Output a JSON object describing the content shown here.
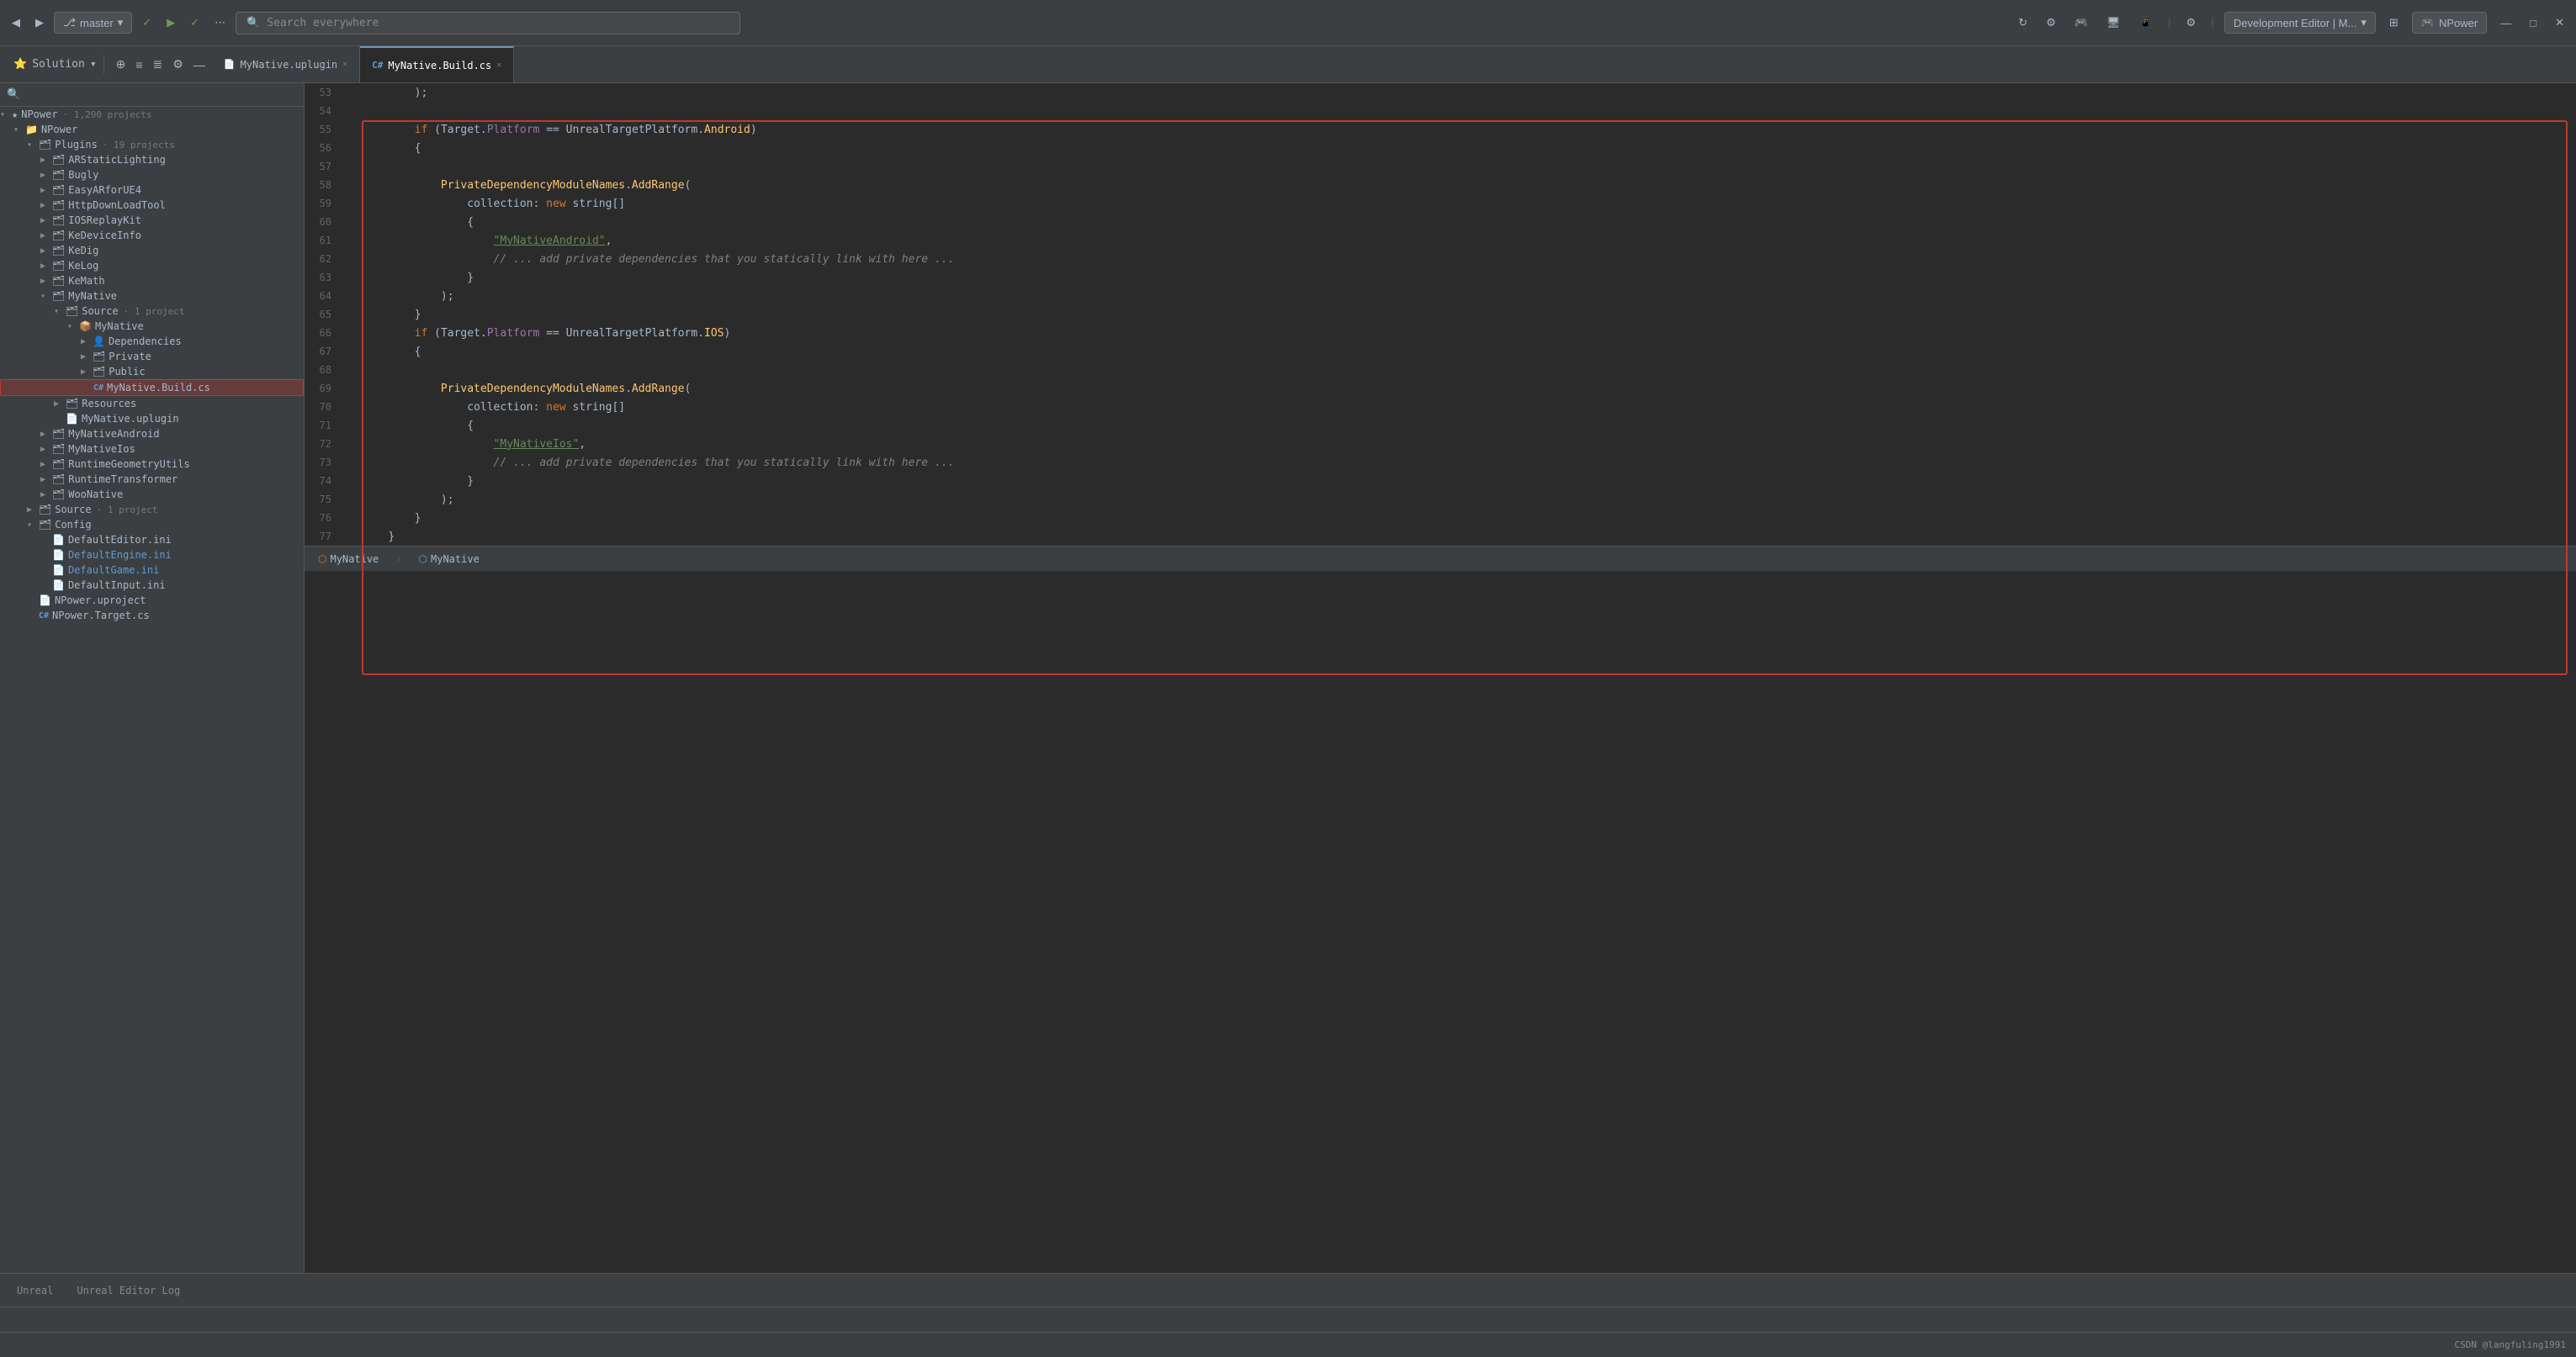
{
  "topbar": {
    "back_icon": "◀",
    "forward_icon": "▶",
    "branch_icon": "⎇",
    "branch_name": "master",
    "check_icon": "✓",
    "run_icon": "▶",
    "build_icon": "🔨",
    "more_icon": "⋯",
    "search_placeholder": "Search everywhere",
    "settings_icon": "⚙",
    "game_icon": "🎮",
    "dev_editor_label": "Development Editor | M...",
    "dropdown_icon": "▾",
    "npower_label": "NPower",
    "window_controls": "— □ ✕"
  },
  "second_toolbar": {
    "solution_label": "Solution",
    "dropdown_icon": "▾",
    "icon1": "⊕",
    "icon2": "≡",
    "icon3": "≣",
    "icon4": "⚙",
    "icon5": "—"
  },
  "file_tabs": [
    {
      "icon": "📄",
      "icon_color": "#cc7832",
      "name": "MyNative.uplugin",
      "active": false,
      "modified": false
    },
    {
      "icon": "C#",
      "icon_color": "#5b9bd5",
      "name": "MyNative.Build.cs",
      "active": true,
      "modified": false
    }
  ],
  "sidebar": {
    "search_placeholder": "",
    "tree": [
      {
        "level": 0,
        "arrow": "▾",
        "icon": "★",
        "label": "NPower",
        "suffix": "· 1,200 projects",
        "color": "normal",
        "indent": 0
      },
      {
        "level": 1,
        "arrow": "▾",
        "icon": "📁",
        "label": "NPower",
        "color": "normal",
        "indent": 1
      },
      {
        "level": 2,
        "arrow": "▾",
        "icon": "🗂",
        "label": "Plugins",
        "suffix": "· 19 projects",
        "color": "normal",
        "indent": 2
      },
      {
        "level": 3,
        "arrow": "▶",
        "icon": "🗂",
        "label": "ARStaticLighting",
        "color": "normal",
        "indent": 3
      },
      {
        "level": 3,
        "arrow": "▶",
        "icon": "🗂",
        "label": "Bugly",
        "color": "normal",
        "indent": 3
      },
      {
        "level": 3,
        "arrow": "▶",
        "icon": "🗂",
        "label": "EasyARforUE4",
        "color": "normal",
        "indent": 3
      },
      {
        "level": 3,
        "arrow": "▶",
        "icon": "🗂",
        "label": "HttpDownLoadTool",
        "color": "normal",
        "indent": 3
      },
      {
        "level": 3,
        "arrow": "▶",
        "icon": "🗂",
        "label": "IOSReplayKit",
        "color": "normal",
        "indent": 3
      },
      {
        "level": 3,
        "arrow": "▶",
        "icon": "🗂",
        "label": "KeDeviceInfo",
        "color": "normal",
        "indent": 3
      },
      {
        "level": 3,
        "arrow": "▶",
        "icon": "🗂",
        "label": "KeDig",
        "color": "normal",
        "indent": 3
      },
      {
        "level": 3,
        "arrow": "▶",
        "icon": "🗂",
        "label": "KeLog",
        "color": "normal",
        "indent": 3
      },
      {
        "level": 3,
        "arrow": "▶",
        "icon": "🗂",
        "label": "KeMath",
        "color": "normal",
        "indent": 3
      },
      {
        "level": 3,
        "arrow": "▾",
        "icon": "🗂",
        "label": "MyNative",
        "color": "normal",
        "indent": 3
      },
      {
        "level": 4,
        "arrow": "▾",
        "icon": "🗂",
        "label": "Source",
        "suffix": "· 1 project",
        "color": "normal",
        "indent": 4
      },
      {
        "level": 5,
        "arrow": "▾",
        "icon": "📦",
        "label": "MyNative",
        "color": "normal",
        "indent": 5
      },
      {
        "level": 6,
        "arrow": "▶",
        "icon": "👤",
        "label": "Dependencies",
        "color": "normal",
        "indent": 6
      },
      {
        "level": 6,
        "arrow": "▶",
        "icon": "🗂",
        "label": "Private",
        "color": "normal",
        "indent": 6
      },
      {
        "level": 6,
        "arrow": "▶",
        "icon": "🗂",
        "label": "Public",
        "color": "normal",
        "indent": 6
      },
      {
        "level": 6,
        "arrow": "",
        "icon": "C#",
        "label": "MyNative.Build.cs",
        "color": "selected",
        "indent": 6
      },
      {
        "level": 4,
        "arrow": "▶",
        "icon": "🗂",
        "label": "Resources",
        "color": "normal",
        "indent": 4
      },
      {
        "level": 4,
        "arrow": "",
        "icon": "📄",
        "label": "MyNative.uplugin",
        "color": "normal",
        "indent": 4
      },
      {
        "level": 3,
        "arrow": "▶",
        "icon": "🗂",
        "label": "MyNativeAndroid",
        "color": "normal",
        "indent": 3
      },
      {
        "level": 3,
        "arrow": "▶",
        "icon": "🗂",
        "label": "MyNativeIos",
        "color": "normal",
        "indent": 3
      },
      {
        "level": 3,
        "arrow": "▶",
        "icon": "🗂",
        "label": "RuntimeGeometryUtils",
        "color": "normal",
        "indent": 3
      },
      {
        "level": 3,
        "arrow": "▶",
        "icon": "🗂",
        "label": "RuntimeTransformer",
        "color": "normal",
        "indent": 3
      },
      {
        "level": 3,
        "arrow": "▶",
        "icon": "🗂",
        "label": "WooNative",
        "color": "normal",
        "indent": 3
      },
      {
        "level": 2,
        "arrow": "▶",
        "icon": "🗂",
        "label": "Source",
        "suffix": "· 1 project",
        "color": "normal",
        "indent": 2
      },
      {
        "level": 2,
        "arrow": "▾",
        "icon": "🗂",
        "label": "Config",
        "color": "normal",
        "indent": 2
      },
      {
        "level": 3,
        "arrow": "",
        "icon": "📄",
        "label": "DefaultEditor.ini",
        "color": "normal",
        "indent": 3
      },
      {
        "level": 3,
        "arrow": "",
        "icon": "📄",
        "label": "DefaultEngine.ini",
        "color": "blue",
        "indent": 3
      },
      {
        "level": 3,
        "arrow": "",
        "icon": "📄",
        "label": "DefaultGame.ini",
        "color": "blue",
        "indent": 3
      },
      {
        "level": 3,
        "arrow": "",
        "icon": "📄",
        "label": "DefaultInput.ini",
        "color": "normal",
        "indent": 3
      },
      {
        "level": 2,
        "arrow": "",
        "icon": "📄",
        "label": "NPower.uproject",
        "color": "normal",
        "indent": 2
      },
      {
        "level": 2,
        "arrow": "",
        "icon": "C#",
        "label": "NPower.Target.cs",
        "color": "normal",
        "indent": 2
      }
    ]
  },
  "code": {
    "lines": [
      {
        "num": 53,
        "content": "        );"
      },
      {
        "num": 54,
        "content": ""
      },
      {
        "num": 55,
        "content": "        if (Target.Platform == UnrealTargetPlatform.Android)",
        "highlight": true
      },
      {
        "num": 56,
        "content": "        {"
      },
      {
        "num": 57,
        "content": ""
      },
      {
        "num": 58,
        "content": "            PrivateDependencyModuleNames.AddRange("
      },
      {
        "num": 59,
        "content": "                collection: new string[]"
      },
      {
        "num": 60,
        "content": "                {"
      },
      {
        "num": 61,
        "content": "                    \"MyNativeAndroid\","
      },
      {
        "num": 62,
        "content": "                    // ... add private dependencies that you statically link with here ..."
      },
      {
        "num": 63,
        "content": "                }"
      },
      {
        "num": 64,
        "content": "            );"
      },
      {
        "num": 65,
        "content": "        }"
      },
      {
        "num": 66,
        "content": "        if (Target.Platform == UnrealTargetPlatform.IOS)"
      },
      {
        "num": 67,
        "content": "        {"
      },
      {
        "num": 68,
        "content": ""
      },
      {
        "num": 69,
        "content": "            PrivateDependencyModuleNames.AddRange("
      },
      {
        "num": 70,
        "content": "                collection: new string[]"
      },
      {
        "num": 71,
        "content": "                {"
      },
      {
        "num": 72,
        "content": "                    \"MyNativeIos\","
      },
      {
        "num": 73,
        "content": "                    // ... add private dependencies that you statically link with here ..."
      },
      {
        "num": 74,
        "content": "                }"
      },
      {
        "num": 75,
        "content": "            );"
      },
      {
        "num": 76,
        "content": "        }"
      },
      {
        "num": 77,
        "content": "    }"
      }
    ]
  },
  "editor_footer": {
    "breadcrumb1_icon": "⬡",
    "breadcrumb1": "MyNative",
    "breadcrumb2_icon": "⬡",
    "breadcrumb2": "MyNative"
  },
  "bottom_tabs": [
    {
      "label": "Unreal",
      "active": false
    },
    {
      "label": "Unreal Editor Log",
      "active": false
    }
  ],
  "status_bar": {
    "right_text": "CSDN @langfuling1991"
  }
}
